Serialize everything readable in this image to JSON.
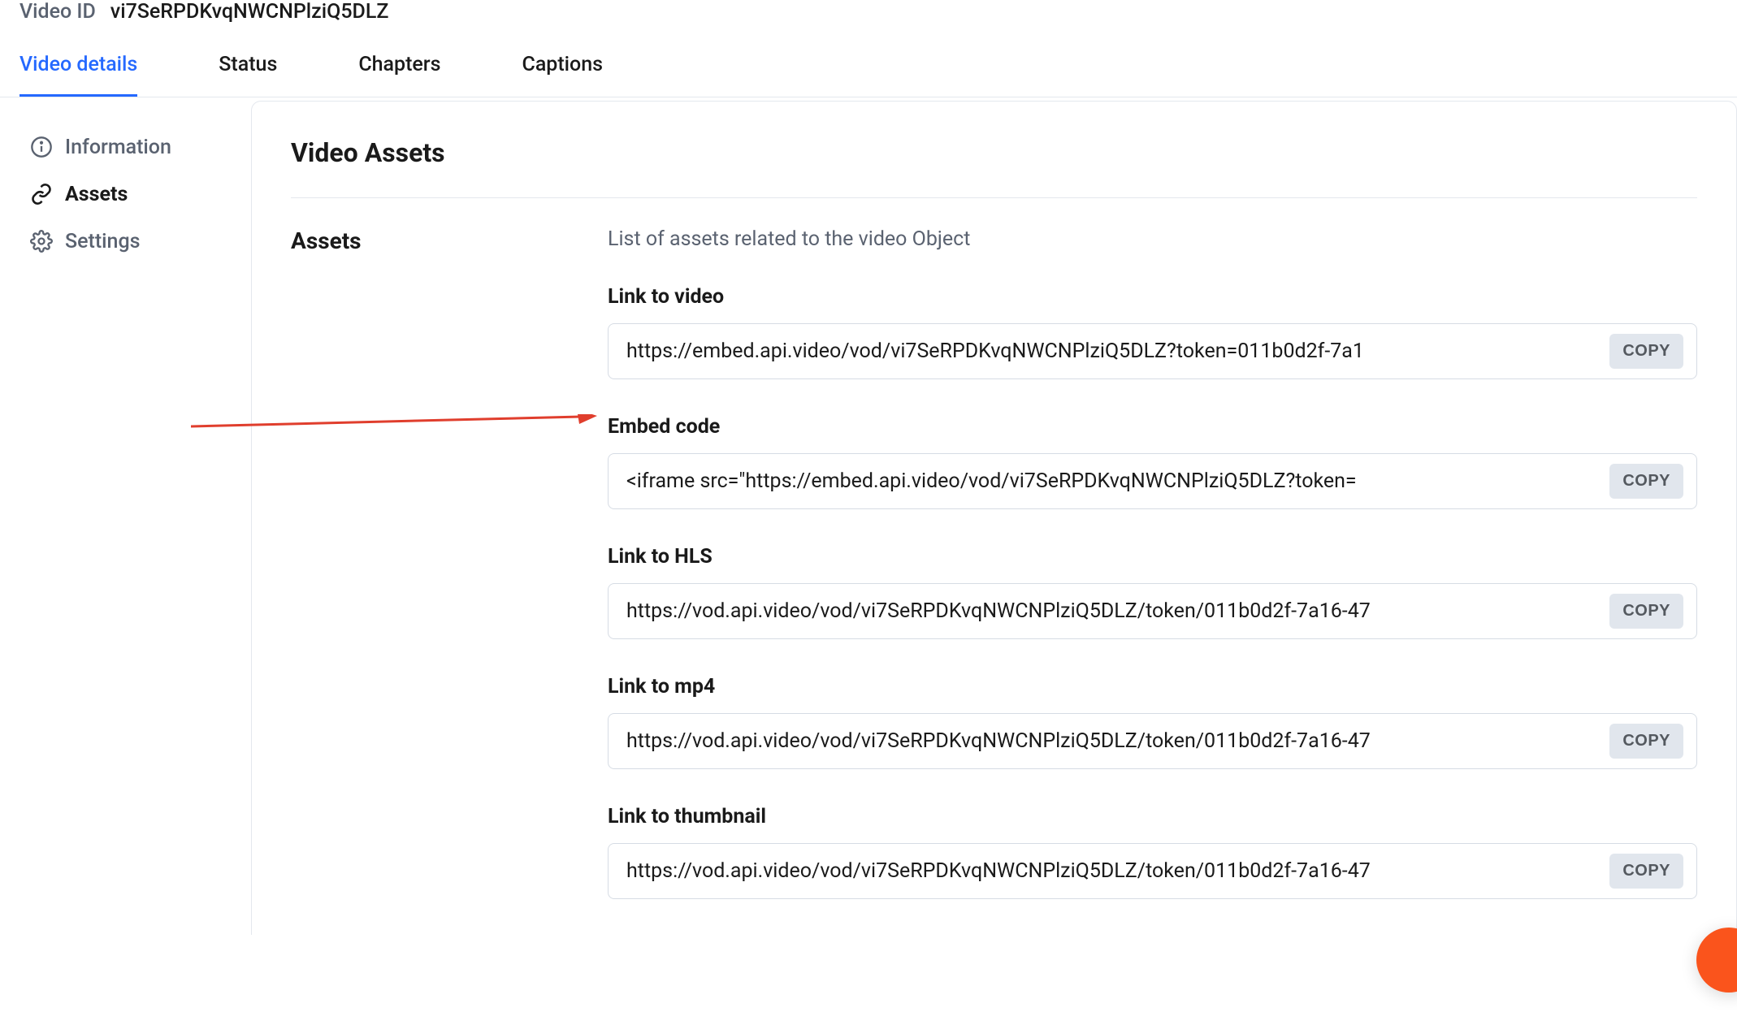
{
  "header": {
    "label": "Video ID",
    "value": "vi7SeRPDKvqNWCNPlziQ5DLZ"
  },
  "tabs": [
    {
      "label": "Video details",
      "active": true
    },
    {
      "label": "Status",
      "active": false
    },
    {
      "label": "Chapters",
      "active": false
    },
    {
      "label": "Captions",
      "active": false
    }
  ],
  "sidebar": [
    {
      "label": "Information",
      "icon": "info-icon",
      "active": false
    },
    {
      "label": "Assets",
      "icon": "link-icon",
      "active": true
    },
    {
      "label": "Settings",
      "icon": "gear-icon",
      "active": false
    }
  ],
  "main": {
    "title": "Video Assets",
    "section_label": "Assets",
    "section_description": "List of assets related to the video Object",
    "copy_label": "COPY",
    "assets": [
      {
        "label": "Link to video",
        "value": "https://embed.api.video/vod/vi7SeRPDKvqNWCNPlziQ5DLZ?token=011b0d2f-7a1"
      },
      {
        "label": "Embed code",
        "value": "<iframe src=\"https://embed.api.video/vod/vi7SeRPDKvqNWCNPlziQ5DLZ?token="
      },
      {
        "label": "Link to HLS",
        "value": "https://vod.api.video/vod/vi7SeRPDKvqNWCNPlziQ5DLZ/token/011b0d2f-7a16-47"
      },
      {
        "label": "Link to mp4",
        "value": "https://vod.api.video/vod/vi7SeRPDKvqNWCNPlziQ5DLZ/token/011b0d2f-7a16-47"
      },
      {
        "label": "Link to thumbnail",
        "value": "https://vod.api.video/vod/vi7SeRPDKvqNWCNPlziQ5DLZ/token/011b0d2f-7a16-47"
      }
    ]
  }
}
